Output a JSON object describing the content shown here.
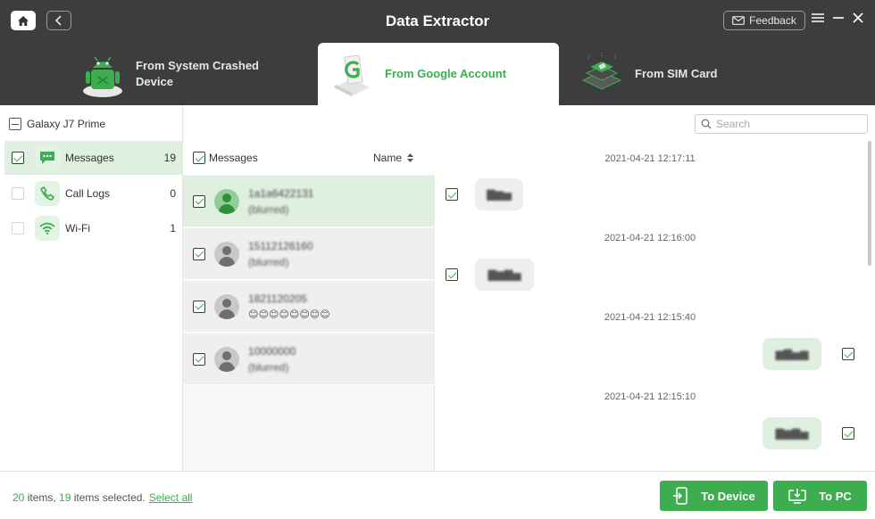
{
  "header": {
    "title": "Data Extractor",
    "feedback_label": "Feedback",
    "tabs": [
      {
        "label": "From System Crashed Device",
        "active": false
      },
      {
        "label": "From Google Account",
        "active": true
      },
      {
        "label": "From SIM Card",
        "active": false
      }
    ]
  },
  "sidebar": {
    "device": "Galaxy J7 Prime",
    "categories": [
      {
        "label": "Messages",
        "count": "19",
        "checked": true,
        "icon": "messages-icon"
      },
      {
        "label": "Call Logs",
        "count": "0",
        "checked": false,
        "icon": "phone-icon"
      },
      {
        "label": "Wi-Fi",
        "count": "1",
        "checked": false,
        "icon": "wifi-icon"
      }
    ]
  },
  "search": {
    "placeholder": "Search"
  },
  "list": {
    "header_label": "Messages",
    "sort_label": "Name",
    "rows": [
      {
        "line1": "1a1a6422131",
        "line2": "(blurred)"
      },
      {
        "line1": "15112126160",
        "line2": "(blurred)"
      },
      {
        "line1": "1821120205",
        "line2": "😊😊😊😊😊😊😊😊"
      },
      {
        "line1": "10000000",
        "line2": "(blurred)"
      }
    ]
  },
  "conversation": {
    "timestamps": [
      "2021-04-21 12:17:11",
      "2021-04-21 12:16:00",
      "2021-04-21 12:15:40",
      "2021-04-21 12:15:10"
    ]
  },
  "footer": {
    "total": "20",
    "items_text": " items, ",
    "selected": "19",
    "selected_text": " items selected.",
    "select_all": "Select all",
    "to_device": "To Device",
    "to_pc": "To PC"
  },
  "colors": {
    "accent": "#3dad4f",
    "header_bg": "#3d3d3d",
    "selected_bg": "#dff0e1"
  }
}
